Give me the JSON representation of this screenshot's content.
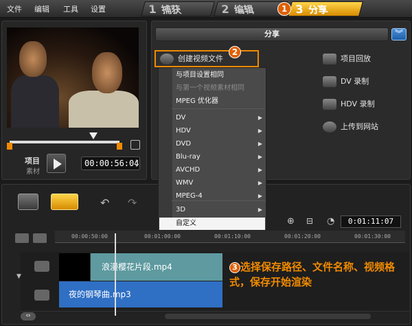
{
  "menu": [
    "文件",
    "编辑",
    "工具",
    "设置"
  ],
  "steps": [
    {
      "num": "1",
      "label": "捕获"
    },
    {
      "num": "2",
      "label": "编辑"
    },
    {
      "num": "3",
      "label": "分享"
    }
  ],
  "annotations": {
    "a1": "1",
    "a2": "2",
    "a3": "3",
    "a3_text": "选择保存路径、文件名称、视频格式，保存开始渲染"
  },
  "preview": {
    "project_label": "项目",
    "clip_label": "素材",
    "timecode": "00:00:56:04"
  },
  "share": {
    "title": "分享",
    "create_file": "创建视频文件",
    "right_options": [
      "项目回放",
      "DV 录制",
      "HDV 录制",
      "上传到网站"
    ]
  },
  "dropdown": {
    "items": [
      {
        "label": "与项目设置相同",
        "disabled": false,
        "submenu": false
      },
      {
        "label": "与第一个视频素材相同",
        "disabled": true,
        "submenu": false
      },
      {
        "label": "MPEG 优化器",
        "disabled": false,
        "submenu": false
      },
      {
        "label": "DV",
        "disabled": false,
        "submenu": true
      },
      {
        "label": "HDV",
        "disabled": false,
        "submenu": true
      },
      {
        "label": "DVD",
        "disabled": false,
        "submenu": true
      },
      {
        "label": "Blu-ray",
        "disabled": false,
        "submenu": true
      },
      {
        "label": "AVCHD",
        "disabled": false,
        "submenu": true
      },
      {
        "label": "WMV",
        "disabled": false,
        "submenu": true
      },
      {
        "label": "MPEG-4",
        "disabled": false,
        "submenu": true
      },
      {
        "label": "3D",
        "disabled": false,
        "submenu": true
      }
    ],
    "custom": "自定义"
  },
  "timeline": {
    "ticks": [
      "00:00:50:00",
      "00:01:00:00",
      "00:01:10:00",
      "00:01:20:00",
      "00:01:30:00"
    ],
    "total_time": "0:01:11:07",
    "video_clip": "浪漫樱花片段.mp4",
    "audio_clip": "夜的钢琴曲.mp3"
  },
  "colors": {
    "accent": "#f08a00",
    "active_step": "#f5b800",
    "audio_clip": "#2f6fc4",
    "video_clip": "#5e9aa0"
  }
}
